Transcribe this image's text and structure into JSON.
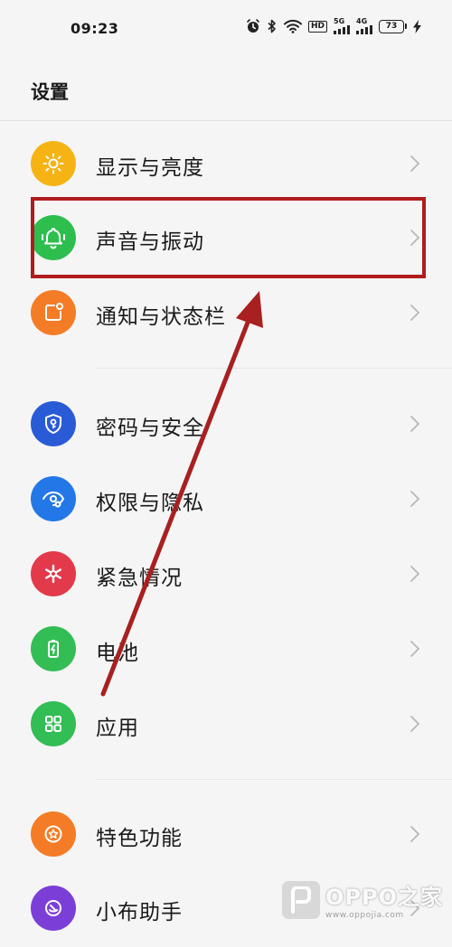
{
  "status_bar": {
    "time": "09:23",
    "network_tag_1": "5G",
    "network_tag_2": "4G",
    "hd_tag": "HD",
    "battery_level": "73"
  },
  "header": {
    "title": "设置"
  },
  "menu": {
    "group1": [
      {
        "label": "显示与亮度",
        "icon": "sun-icon",
        "color": "#F6B314"
      },
      {
        "label": "声音与振动",
        "icon": "bell-icon",
        "color": "#2DBE4E"
      },
      {
        "label": "通知与状态栏",
        "icon": "notification-icon",
        "color": "#F47C26"
      }
    ],
    "group2": [
      {
        "label": "密码与安全",
        "icon": "shield-key-icon",
        "color": "#2A5BD7"
      },
      {
        "label": "权限与隐私",
        "icon": "eye-icon",
        "color": "#2477E6"
      },
      {
        "label": "紧急情况",
        "icon": "asterisk-icon",
        "color": "#E23A4B"
      },
      {
        "label": "电池",
        "icon": "battery-icon",
        "color": "#33BD55"
      },
      {
        "label": "应用",
        "icon": "apps-grid-icon",
        "color": "#33BD55"
      }
    ],
    "group3": [
      {
        "label": "特色功能",
        "icon": "star-icon",
        "color": "#F47C26"
      },
      {
        "label": "小布助手",
        "icon": "assistant-icon",
        "color": "#7B3FD8"
      }
    ]
  },
  "annotation": {
    "highlight_color": "#B01C1C"
  },
  "watermark": {
    "main": "OPPO之家",
    "sub": "www.oppojia.com"
  }
}
